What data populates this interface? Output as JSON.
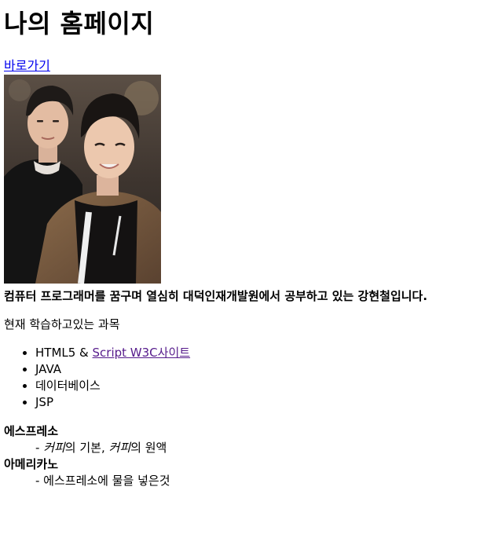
{
  "page": {
    "title": "나의 홈페이지",
    "shortcut_link": "바로가기",
    "photo_alt": "두 사람의 셀카 사진",
    "intro": "컴퓨터 프로그래머를 꿈구며 열심히 대덕인재개발원에서 공부하고 있는 강현철입니다.",
    "courses_heading": "현재 학습하고있는 과목"
  },
  "courses": {
    "item1_prefix": "HTML5 & ",
    "item1_link": "Script W3C사이트",
    "item2": "JAVA",
    "item3": "데이터베이스",
    "item4": "JSP"
  },
  "glossary": {
    "term1": "에스프레소",
    "def1_dash": "- ",
    "def1_em1": "커피",
    "def1_mid": "의 기본, ",
    "def1_em2": "커피",
    "def1_end": "의 원액",
    "term2": "아메리카노",
    "def2": "- 에스프레소에 물을 넣은것"
  },
  "colors": {
    "link": "#0000ee",
    "visited_link": "#551a8b",
    "background": "#ffffff",
    "text": "#000000"
  }
}
